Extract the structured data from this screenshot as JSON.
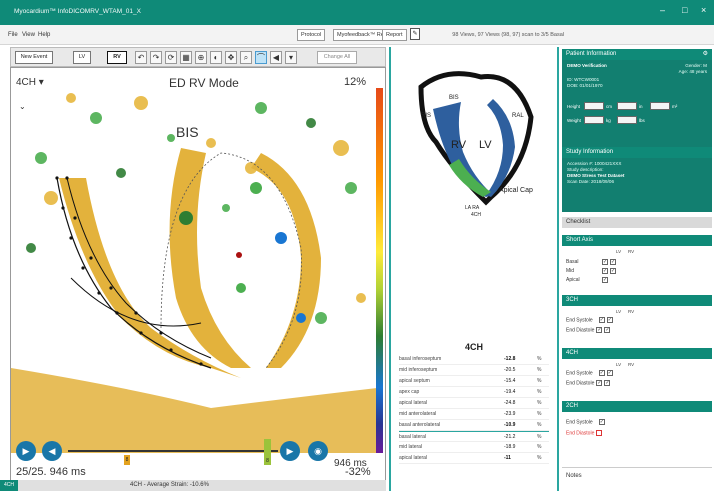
{
  "window": {
    "title": "Myocardium™ InfoDICOMRV_WTAM_01_X"
  },
  "menu": {
    "file": "File",
    "view": "View",
    "help": "Help",
    "btn_protocol": "Protocol",
    "btn_myofeedback": "Myofeedback™ Review",
    "btn_report": "Report",
    "status": "98 Views, 97 Views (98, 97) scan to 3/5 Basal"
  },
  "toolbar": {
    "new_event": "New Event",
    "btn_lv": "LV",
    "btn_rv": "RV",
    "change": "Change All"
  },
  "viewer": {
    "view_select": "4CH",
    "mode_label": "ED RV Mode",
    "scale_max": "12%",
    "scale_min": "-32%",
    "segment_label": "BIS",
    "frame_info": "25/25. 946 ms",
    "time_right": "946 ms",
    "slider_marker_left": "8",
    "slider_marker_right": "8"
  },
  "footer": {
    "tag": "4CH",
    "avg_strain": "4CH - Average Strain: -10.6%"
  },
  "diagram": {
    "labels": {
      "bis": "BIS",
      "ris": "RIS",
      "rv": "RV",
      "lv": "LV",
      "ral": "RAL",
      "apical_cap": "Apical Cap",
      "bottom1": "LA RA",
      "bottom2": "4CH"
    },
    "colors": {
      "rv_blue": "#2e5f9e",
      "green": "#4caf50",
      "outline": "#111111"
    }
  },
  "segments": {
    "title": "4CH",
    "rows": [
      {
        "name": "basal inferoseptum",
        "value": "-12.8",
        "unit": "%",
        "bold": true
      },
      {
        "name": "mid inferoseptum",
        "value": "-20.5",
        "unit": "%",
        "bold": false
      },
      {
        "name": "apical septum",
        "value": "-15.4",
        "unit": "%",
        "bold": false
      },
      {
        "name": "apex cap",
        "value": "-19.4",
        "unit": "%",
        "bold": false
      },
      {
        "name": "apical lateral",
        "value": "-24.8",
        "unit": "%",
        "bold": false
      },
      {
        "name": "mid anterolateral",
        "value": "-23.9",
        "unit": "%",
        "bold": false
      },
      {
        "name": "basal anterolateral",
        "value": "-10.9",
        "unit": "%",
        "bold": true
      },
      {
        "name": "basal lateral",
        "value": "-21.2",
        "unit": "%",
        "bold": false
      },
      {
        "name": "mid lateral",
        "value": "-18.9",
        "unit": "%",
        "bold": false
      },
      {
        "name": "apical lateral",
        "value": "-11",
        "unit": "%",
        "bold": true
      }
    ]
  },
  "right": {
    "patient_header": "Patient Information",
    "patient_name": "DEMO Verification",
    "patient_gender": "Gender: M",
    "patient_age": "Age: 48 years",
    "patient_id": "ID: WTCW0001",
    "patient_dob": "DOB: 01/01/1970",
    "height_label": "Height",
    "weight_label": "Weight",
    "unit_cm": "cm",
    "unit_kg": "kg",
    "unit_bsa": "m²",
    "unit_in": "in",
    "unit_lbs": "lbs",
    "study_header": "Study Information",
    "accession": "Accession #: 1000421XXX",
    "study_desc": "Study description:",
    "study_name": "DEMO Stress Test Dataset",
    "scan_date": "Scan Date: 2018/09/06",
    "checklist_header": "Checklist",
    "short_axis": "Short Axis",
    "sa_rows": [
      "Basal",
      "Mid",
      "Apical"
    ],
    "ch3": "3CH",
    "ch4": "4CH",
    "ch2": "2CH",
    "end_systole": "End Systole",
    "end_diastole": "End Diastole",
    "col_lv": "LV",
    "col_rv": "RV",
    "notes": "Notes"
  }
}
